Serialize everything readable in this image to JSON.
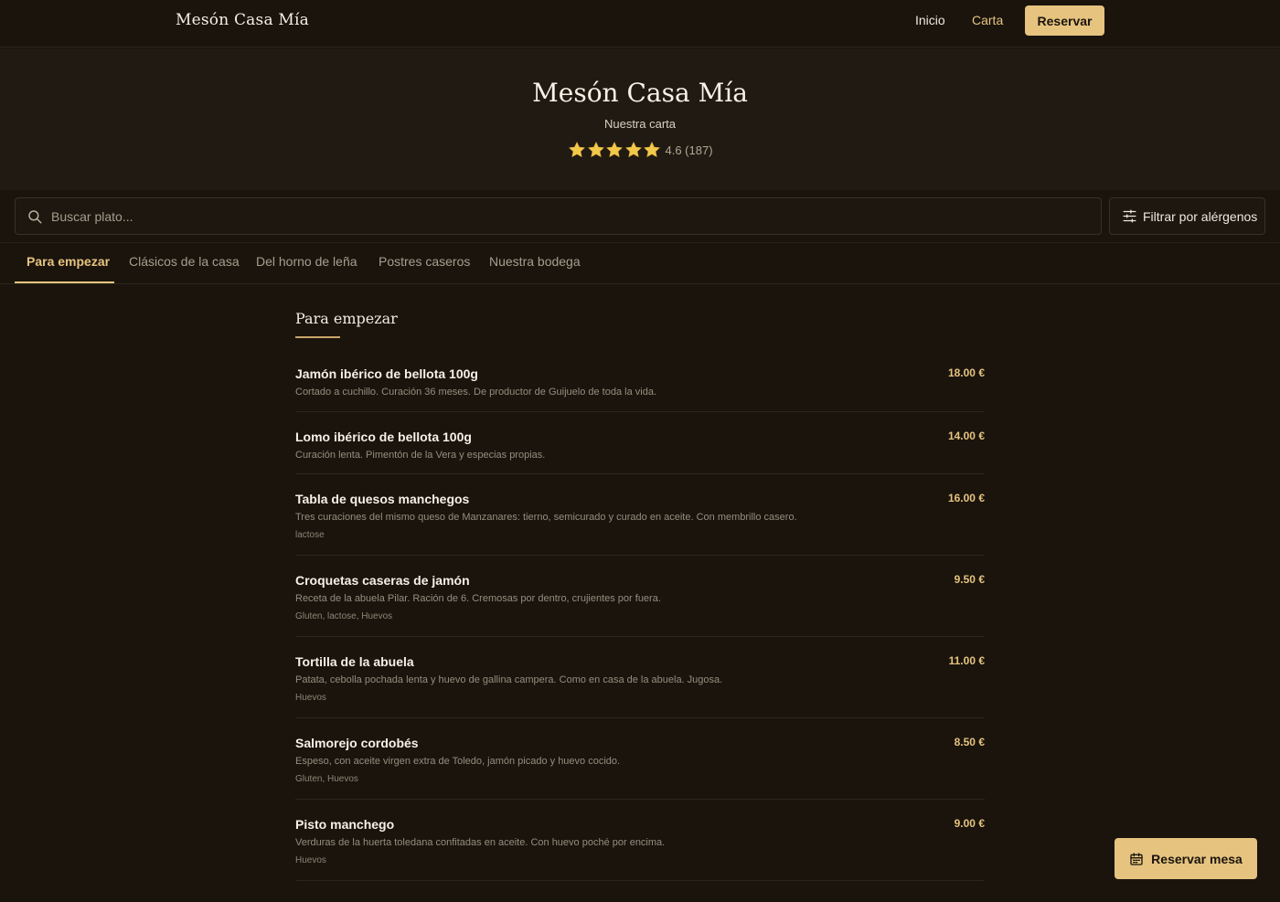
{
  "nav": {
    "brand": "Mesón Casa Mía",
    "links": [
      {
        "label": "Inicio",
        "active": false
      },
      {
        "label": "Carta",
        "active": true
      }
    ],
    "cta_label": "Reservar"
  },
  "hero": {
    "title": "Mesón Casa Mía",
    "subtitle": "Nuestra carta",
    "rating": {
      "stars": 5,
      "text": "4.6 (187)"
    }
  },
  "search": {
    "placeholder": "Buscar plato...",
    "value": ""
  },
  "filter": {
    "label": "Filtrar por alérgenos"
  },
  "tabs": [
    {
      "label": "Para empezar",
      "active": true
    },
    {
      "label": "Clásicos de la casa",
      "active": false
    },
    {
      "label": "Del horno de leña",
      "active": false
    },
    {
      "label": "Postres caseros",
      "active": false
    },
    {
      "label": "Nuestra bodega",
      "active": false
    }
  ],
  "section": {
    "title": "Para empezar",
    "items": [
      {
        "name": "Jamón ibérico de bellota 100g",
        "description": "Cortado a cuchillo. Curación 36 meses. De productor de Guijuelo de toda la vida.",
        "allergens": "",
        "price": "18.00 €"
      },
      {
        "name": "Lomo ibérico de bellota 100g",
        "description": "Curación lenta. Pimentón de la Vera y especias propias.",
        "allergens": "",
        "price": "14.00 €"
      },
      {
        "name": "Tabla de quesos manchegos",
        "description": "Tres curaciones del mismo queso de Manzanares: tierno, semicurado y curado en aceite. Con membrillo casero.",
        "allergens": "lactose",
        "price": "16.00 €"
      },
      {
        "name": "Croquetas caseras de jamón",
        "description": "Receta de la abuela Pilar. Ración de 6. Cremosas por dentro, crujientes por fuera.",
        "allergens": "Gluten, lactose, Huevos",
        "price": "9.50 €"
      },
      {
        "name": "Tortilla de la abuela",
        "description": "Patata, cebolla pochada lenta y huevo de gallina campera. Como en casa de la abuela. Jugosa.",
        "allergens": "Huevos",
        "price": "11.00 €"
      },
      {
        "name": "Salmorejo cordobés",
        "description": "Espeso, con aceite virgen extra de Toledo, jamón picado y huevo cocido.",
        "allergens": "Gluten, Huevos",
        "price": "8.50 €"
      },
      {
        "name": "Pisto manchego",
        "description": "Verduras de la huerta toledana confitadas en aceite. Con huevo poché por encima.",
        "allergens": "Huevos",
        "price": "9.00 €"
      }
    ]
  },
  "fab": {
    "label": "Reservar mesa"
  },
  "colors": {
    "background": "#1a140d",
    "hero_background": "#211a12",
    "accent": "#e6c37f",
    "text": "#f2ece2",
    "muted": "#978d7e"
  },
  "icons": {
    "star": "star-icon",
    "search": "search-icon",
    "filter": "sliders-icon",
    "calendar": "calendar-icon"
  }
}
